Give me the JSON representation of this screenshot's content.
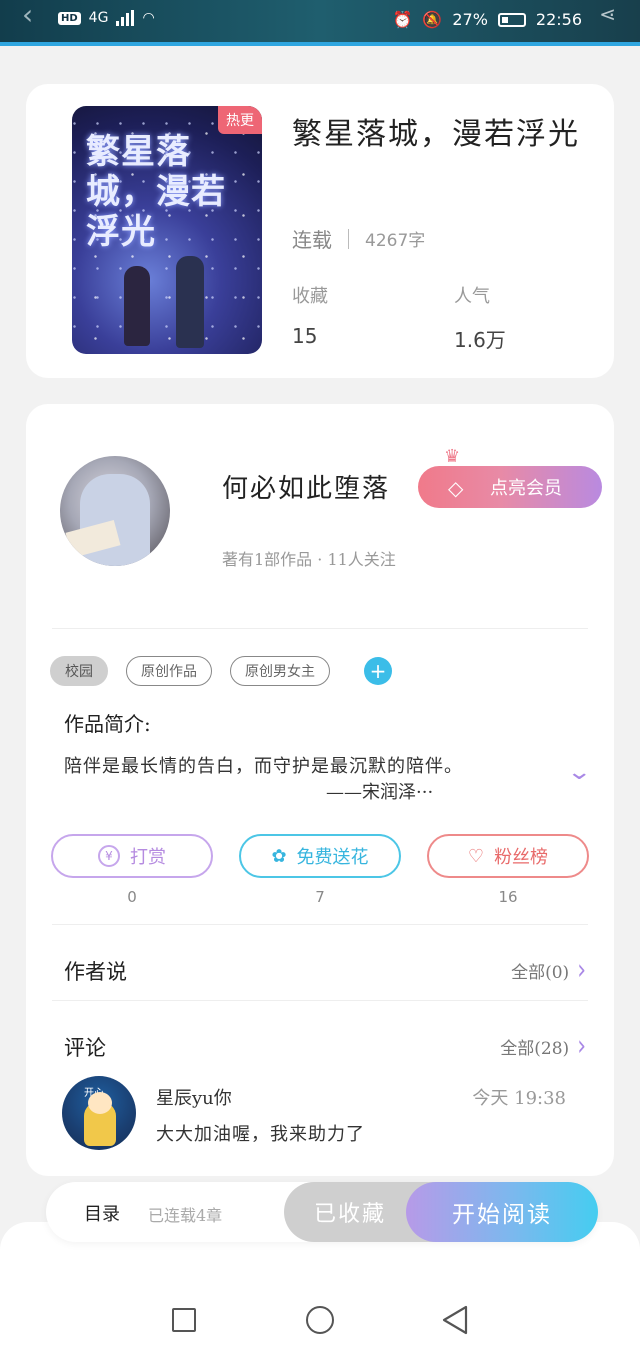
{
  "status_bar": {
    "network": "4G",
    "hd": "HD",
    "battery": "27%",
    "time": "22:56"
  },
  "book": {
    "cover_title": "繁星落城，漫若浮光",
    "hot_badge": "热更",
    "title": "繁星落城，漫若浮光",
    "status": "连载",
    "word_count": "4267字",
    "favorites_label": "收藏",
    "favorites_value": "15",
    "popularity_label": "人气",
    "popularity_value": "1.6万"
  },
  "author": {
    "name": "何必如此堕落",
    "vip_button": "点亮会员",
    "summary": "著有1部作品 · 11人关注"
  },
  "tags": [
    "校园",
    "原创作品",
    "原创男女主"
  ],
  "intro": {
    "label": "作品简介:",
    "line1": "陪伴是最长情的告白，而守护是最沉默的陪伴。",
    "line2": "——宋润泽···"
  },
  "actions": [
    {
      "label": "打赏",
      "icon": "yen-icon",
      "count": "0"
    },
    {
      "label": "免费送花",
      "icon": "flower-icon",
      "count": "7"
    },
    {
      "label": "粉丝榜",
      "icon": "fan-icon",
      "count": "16"
    }
  ],
  "author_says": {
    "title": "作者说",
    "more": "全部(0)"
  },
  "comments": {
    "title": "评论",
    "more": "全部(28)",
    "items": [
      {
        "user": "星辰yu你",
        "time": "今天  19:38",
        "text": "大大加油喔，我来助力了",
        "avatar_text": "开心"
      }
    ]
  },
  "bottom_bar": {
    "toc_label": "目录",
    "toc_sub": "已连载4章",
    "favorited": "已收藏",
    "start_reading": "开始阅读"
  },
  "colors": {
    "accent_blue": "#45cdf0",
    "accent_purple": "#b79ae8",
    "hot": "#ee6675"
  }
}
